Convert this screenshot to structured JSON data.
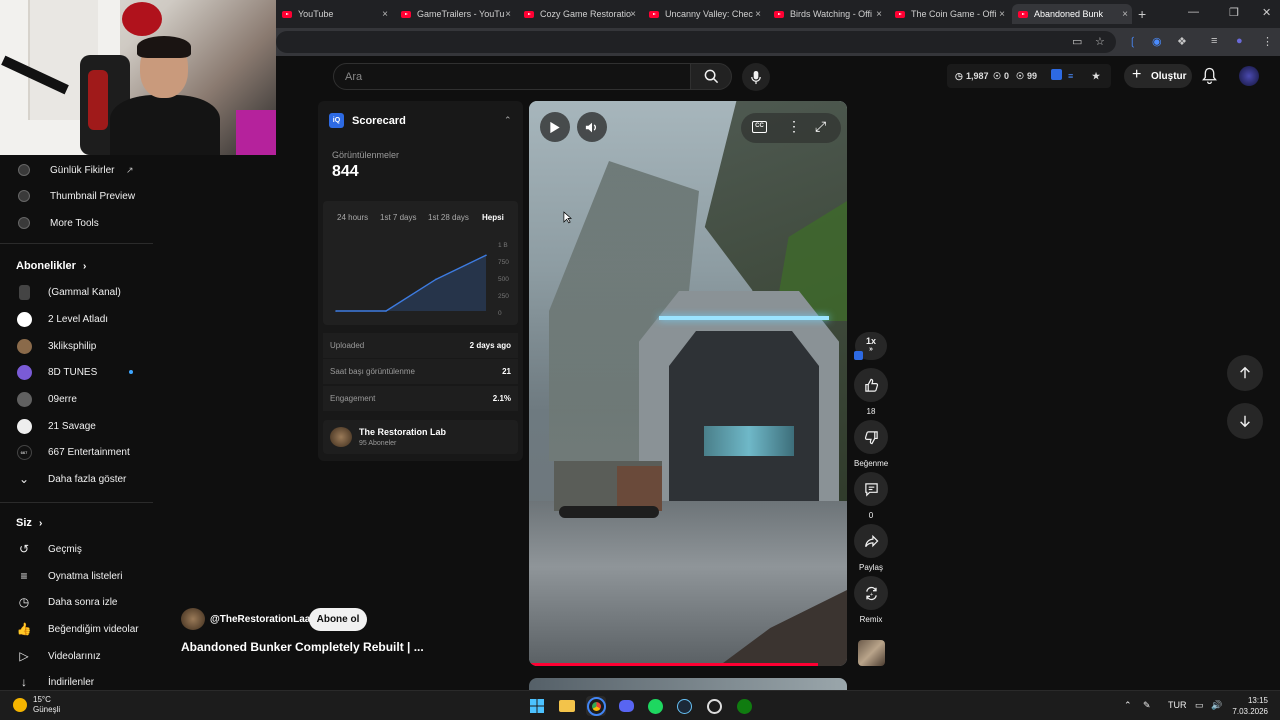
{
  "browser": {
    "tabs": [
      {
        "label": "YouTube",
        "active": false
      },
      {
        "label": "GameTrailers - YouTu",
        "active": false
      },
      {
        "label": "Cozy Game Restoratio",
        "active": false
      },
      {
        "label": "Uncanny Valley: Chec",
        "active": false
      },
      {
        "label": "Birds Watching - Offi",
        "active": false
      },
      {
        "label": "The Coin Game - Offi",
        "active": false
      },
      {
        "label": "Abandoned Bunk",
        "active": true
      }
    ],
    "close_glyph": "×",
    "new_tab_glyph": "+"
  },
  "header": {
    "search_placeholder": "Ara",
    "stats": {
      "views": "1,987",
      "likes": "0",
      "watch": "99"
    },
    "create_label": "Oluştur"
  },
  "sidebar": {
    "tools": [
      {
        "label": "Günlük Fikirler",
        "icon": "external-link-icon"
      },
      {
        "label": "Thumbnail Preview"
      },
      {
        "label": "More Tools"
      }
    ],
    "subscriptions_heading": "Abonelikler",
    "subscriptions": [
      {
        "label": "(Gammal Kanal)",
        "color": "#444444"
      },
      {
        "label": "2 Level Atladı",
        "color": "#ffffff"
      },
      {
        "label": "3kliksphilip",
        "color": "#8a6a4a"
      },
      {
        "label": "8D TUNES",
        "color": "#7a5bd6",
        "dot": true
      },
      {
        "label": "09erre",
        "color": "#606060"
      },
      {
        "label": "21 Savage",
        "color": "#eeeeee"
      },
      {
        "label": "667 Entertainment",
        "color": "#111111",
        "badge": "667"
      }
    ],
    "show_more": "Daha fazla göster",
    "you_heading": "Siz",
    "you_items": [
      {
        "label": "Geçmiş",
        "icon": "history-icon"
      },
      {
        "label": "Oynatma listeleri",
        "icon": "playlists-icon"
      },
      {
        "label": "Daha sonra izle",
        "icon": "watch-later-icon"
      },
      {
        "label": "Beğendiğim videolar",
        "icon": "liked-videos-icon"
      },
      {
        "label": "Videolarınız",
        "icon": "your-videos-icon"
      },
      {
        "label": "İndirilenler",
        "icon": "downloads-icon"
      }
    ]
  },
  "scorecard": {
    "logo": "iQ",
    "title": "Scorecard",
    "views_label": "Görüntülenmeler",
    "views_value": "844",
    "tabs": [
      "24 hours",
      "1st 7 days",
      "1st 28 days",
      "Hepsi"
    ],
    "active_tab": "Hepsi",
    "rows": [
      {
        "key": "Uploaded",
        "value": "2 days ago"
      },
      {
        "key": "Saat başı görüntülenme",
        "value": "21"
      },
      {
        "key": "Engagement",
        "value": "2.1%"
      }
    ],
    "channel_name": "The Restoration Lab",
    "channel_subs": "95 Aboneler"
  },
  "chart_data": {
    "type": "area",
    "x": [
      0,
      1,
      2,
      3
    ],
    "values": [
      0,
      0,
      480,
      844
    ],
    "ylim": [
      0,
      1000
    ],
    "yticks": [
      "1 B",
      "750",
      "500",
      "250",
      "0"
    ],
    "color": "#3d7be0"
  },
  "short": {
    "channel_handle": "@TheRestorationLaab",
    "subscribe_label": "Abone ol",
    "title": "Abandoned Bunker Completely Rebuilt | ...",
    "progress": 0.91
  },
  "actions": {
    "speed": "1x",
    "like_count": "18",
    "dislike_label": "Beğenme",
    "comments_count": "0",
    "share_label": "Paylaş",
    "remix_label": "Remix"
  },
  "taskbar": {
    "temp": "15°C",
    "weather": "Güneşli",
    "lang": "TUR",
    "time": "13:15",
    "date": "7.03.2026"
  }
}
